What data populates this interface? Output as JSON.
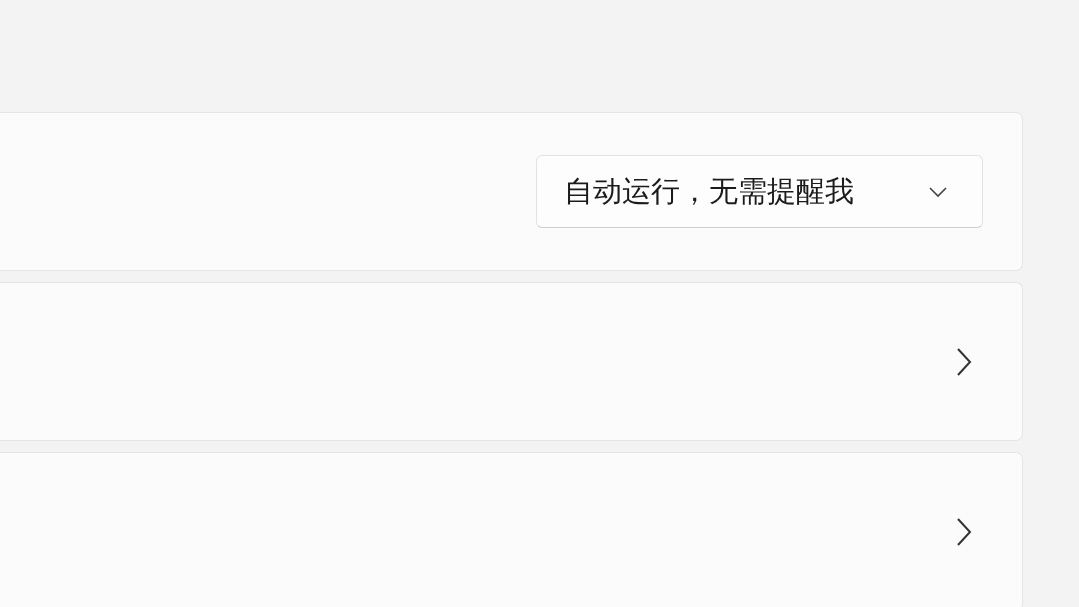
{
  "cards": [
    {
      "kind": "dropdown",
      "value": "自动运行，无需提醒我"
    },
    {
      "kind": "link"
    },
    {
      "kind": "link"
    }
  ]
}
